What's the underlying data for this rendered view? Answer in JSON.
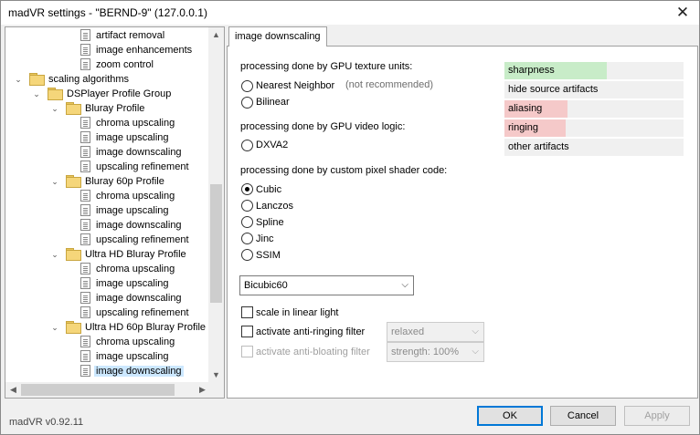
{
  "window": {
    "title": "madVR settings - \"BERND-9\" (127.0.0.1)",
    "close_glyph": "✕"
  },
  "tree": {
    "items": [
      {
        "label": "artifact removal",
        "type": "doc"
      },
      {
        "label": "image enhancements",
        "type": "doc"
      },
      {
        "label": "zoom control",
        "type": "doc"
      },
      {
        "label": "scaling algorithms",
        "type": "folder",
        "expanded": true
      },
      {
        "label": "DSPlayer Profile Group",
        "type": "folder",
        "expanded": true
      },
      {
        "label": "Bluray Profile",
        "type": "folder",
        "expanded": true
      },
      {
        "label": "chroma upscaling",
        "type": "doc"
      },
      {
        "label": "image upscaling",
        "type": "doc"
      },
      {
        "label": "image downscaling",
        "type": "doc"
      },
      {
        "label": "upscaling refinement",
        "type": "doc"
      },
      {
        "label": "Bluray 60p Profile",
        "type": "folder",
        "expanded": true
      },
      {
        "label": "chroma upscaling",
        "type": "doc"
      },
      {
        "label": "image upscaling",
        "type": "doc"
      },
      {
        "label": "image downscaling",
        "type": "doc"
      },
      {
        "label": "upscaling refinement",
        "type": "doc"
      },
      {
        "label": "Ultra HD Bluray Profile",
        "type": "folder",
        "expanded": true
      },
      {
        "label": "chroma upscaling",
        "type": "doc"
      },
      {
        "label": "image upscaling",
        "type": "doc"
      },
      {
        "label": "image downscaling",
        "type": "doc"
      },
      {
        "label": "upscaling refinement",
        "type": "doc"
      },
      {
        "label": "Ultra HD 60p Bluray Profile",
        "type": "folder",
        "expanded": true
      },
      {
        "label": "chroma upscaling",
        "type": "doc"
      },
      {
        "label": "image upscaling",
        "type": "doc"
      },
      {
        "label": "image downscaling",
        "type": "doc",
        "selected": true
      }
    ]
  },
  "tab": {
    "label": "image downscaling"
  },
  "gpu_texture": {
    "heading": "processing done by GPU texture units:",
    "nearest": "Nearest Neighbor",
    "nearest_note": "(not recommended)",
    "bilinear": "Bilinear"
  },
  "gpu_video": {
    "heading": "processing done by GPU video logic:",
    "dxva2": "DXVA2"
  },
  "shader": {
    "heading": "processing done by custom pixel shader code:",
    "options": [
      "Cubic",
      "Lanczos",
      "Spline",
      "Jinc",
      "SSIM"
    ],
    "selected": "Cubic"
  },
  "algorithm_select": {
    "value": "Bicubic60"
  },
  "options": {
    "linear_light": "scale in linear light",
    "anti_ringing": "activate anti-ringing filter",
    "anti_ringing_value": "relaxed",
    "anti_bloating": "activate anti-bloating filter",
    "anti_bloating_value": "strength: 100%"
  },
  "quality_legend": [
    {
      "label": "sharpness",
      "color": "#c8ecc8",
      "level": 0.57
    },
    {
      "label": "hide source artifacts",
      "color": "#f0f0f0",
      "level": 0
    },
    {
      "label": "aliasing",
      "color": "#f5c9c9",
      "level": 0.35
    },
    {
      "label": "ringing",
      "color": "#f5c9c9",
      "level": 0.34
    },
    {
      "label": "other artifacts",
      "color": "#f0f0f0",
      "level": 0
    }
  ],
  "footer": {
    "version": "madVR v0.92.11",
    "ok": "OK",
    "cancel": "Cancel",
    "apply": "Apply"
  }
}
